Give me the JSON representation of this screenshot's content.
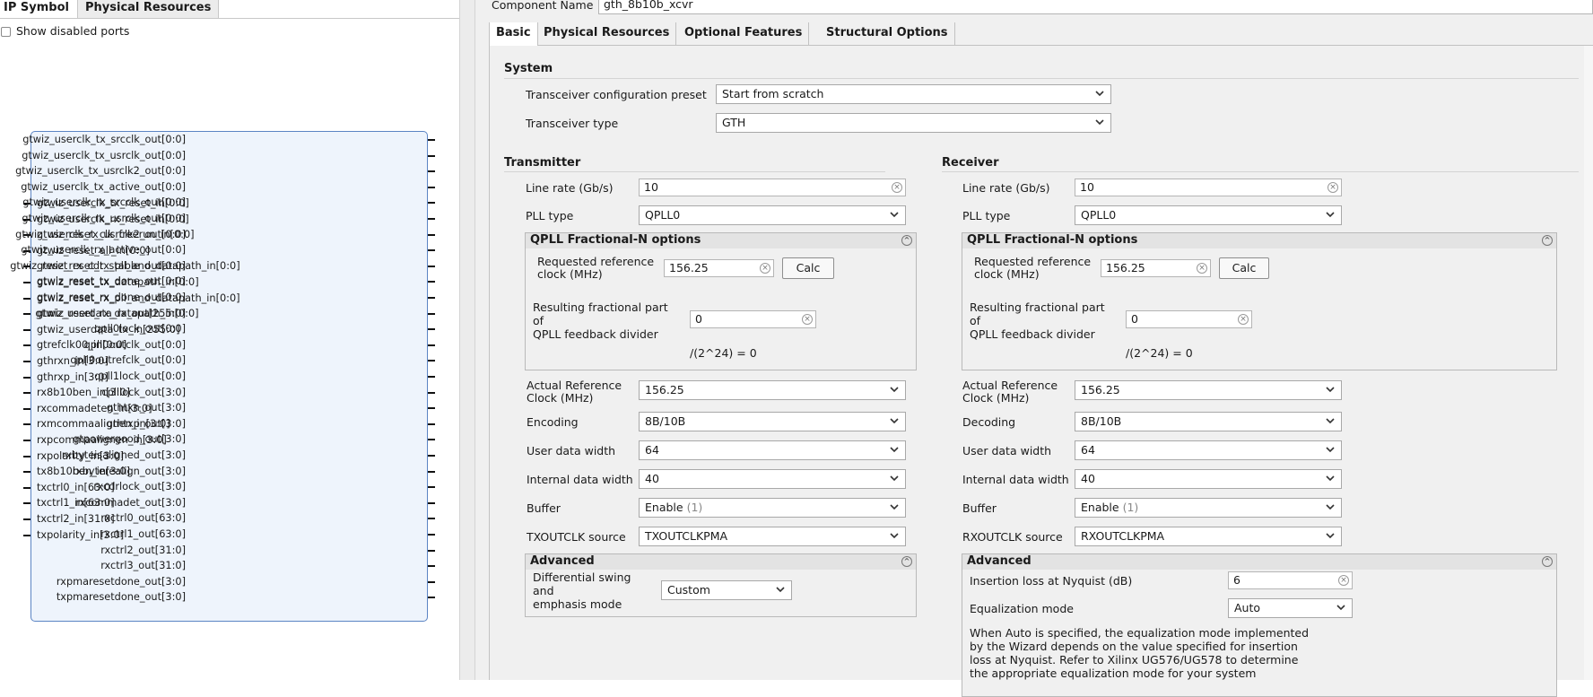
{
  "left_tabs": [
    "IP Symbol",
    "Physical Resources"
  ],
  "show_disabled_ports": "Show disabled ports",
  "input_ports": [
    "gtwiz_userclk_tx_reset_in[0:0]",
    "gtwiz_userclk_rx_reset_in[0:0]",
    "gtwiz_reset_clk_freerun_in[0:0]",
    "gtwiz_reset_all_in[0:0]",
    "gtwiz_reset_tx_pll_and_datapath_in[0:0]",
    "gtwiz_reset_tx_datapath_in[0:0]",
    "gtwiz_reset_rx_pll_and_datapath_in[0:0]",
    "gtwiz_reset_rx_datapath_in[0:0]",
    "gtwiz_userdata_tx_in[255:0]",
    "gtrefclk00_in[0:0]",
    "gthrxn_in[3:0]",
    "gthrxp_in[3:0]",
    "rx8b10ben_in[3:0]",
    "rxcommadeten_in[3:0]",
    "rxmcommaalignen_in[3:0]",
    "rxpcommaalignen_in[3:0]",
    "rxpolarity_in[3:0]",
    "tx8b10ben_in[3:0]",
    "txctrl0_in[63:0]",
    "txctrl1_in[63:0]",
    "txctrl2_in[31:0]",
    "txpolarity_in[3:0]"
  ],
  "output_ports": [
    "gtwiz_userclk_tx_srcclk_out[0:0]",
    "gtwiz_userclk_tx_usrclk_out[0:0]",
    "gtwiz_userclk_tx_usrclk2_out[0:0]",
    "gtwiz_userclk_tx_active_out[0:0]",
    "gtwiz_userclk_rx_srcclk_out[0:0]",
    "gtwiz_userclk_rx_usrclk_out[0:0]",
    "gtwiz_userclk_rx_usrclk2_out[0:0]",
    "gtwiz_userclk_rx_active_out[0:0]",
    "gtwiz_reset_rx_cdr_stable_out[0:0]",
    "gtwiz_reset_tx_done_out[0:0]",
    "gtwiz_reset_rx_done_out[0:0]",
    "gtwiz_userdata_rx_out[255:0]",
    "qpll0lock_out[0:0]",
    "qpll0outclk_out[0:0]",
    "qpll0outrefclk_out[0:0]",
    "qpll1lock_out[0:0]",
    "cplllock_out[3:0]",
    "gthtxn_out[3:0]",
    "gthtxp_out[3:0]",
    "gtpowergood_out[3:0]",
    "rxbyteisaligned_out[3:0]",
    "rxbyterealign_out[3:0]",
    "rxcdrlock_out[3:0]",
    "rxcommadet_out[3:0]",
    "rxctrl0_out[63:0]",
    "rxctrl1_out[63:0]",
    "rxctrl2_out[31:0]",
    "rxctrl3_out[31:0]",
    "rxpmaresetdone_out[3:0]",
    "txpmaresetdone_out[3:0]"
  ],
  "component": {
    "label": "Component Name",
    "value": "gth_8b10b_xcvr"
  },
  "right_tabs": [
    "Basic",
    "Physical Resources",
    "Optional Features",
    "Structural Options"
  ],
  "system": {
    "title": "System",
    "preset_label": "Transceiver configuration preset",
    "preset_value": "Start from scratch",
    "type_label": "Transceiver type",
    "type_value": "GTH"
  },
  "transmitter": {
    "title": "Transmitter",
    "line_rate_label": "Line rate (Gb/s)",
    "line_rate": "10",
    "pll_type_label": "PLL type",
    "pll_type": "QPLL0",
    "qpll_title": "QPLL Fractional-N options",
    "req_ref_label1": "Requested reference",
    "req_ref_label2": "clock (MHz)",
    "req_ref": "156.25",
    "calc": "Calc",
    "frac_label1": "Resulting fractional part",
    "frac_label2": "of",
    "frac_label3": "QPLL feedback divider",
    "frac": "0",
    "frac_suffix": "/(2^24) = 0",
    "actual_ref_label1": "Actual Reference",
    "actual_ref_label2": "Clock (MHz)",
    "actual_ref": "156.25",
    "encoding_label": "Encoding",
    "encoding": "8B/10B",
    "user_width_label": "User data width",
    "user_width": "64",
    "internal_width_label": "Internal data width",
    "internal_width": "40",
    "buffer_label": "Buffer",
    "buffer": "Enable",
    "buffer_hint": "(1)",
    "outclk_label": "TXOUTCLK source",
    "outclk": "TXOUTCLKPMA",
    "advanced_title": "Advanced",
    "swing_label1": "Differential swing",
    "swing_label2": "and",
    "swing_label3": "emphasis mode",
    "swing": "Custom"
  },
  "receiver": {
    "title": "Receiver",
    "line_rate_label": "Line rate (Gb/s)",
    "line_rate": "10",
    "pll_type_label": "PLL type",
    "pll_type": "QPLL0",
    "qpll_title": "QPLL Fractional-N options",
    "req_ref_label1": "Requested reference",
    "req_ref_label2": "clock (MHz)",
    "req_ref": "156.25",
    "calc": "Calc",
    "frac_label1": "Resulting fractional part",
    "frac_label2": "of",
    "frac_label3": "QPLL feedback divider",
    "frac": "0",
    "frac_suffix": "/(2^24) = 0",
    "actual_ref_label1": "Actual Reference",
    "actual_ref_label2": "Clock (MHz)",
    "actual_ref": "156.25",
    "decoding_label": "Decoding",
    "decoding": "8B/10B",
    "user_width_label": "User data width",
    "user_width": "64",
    "internal_width_label": "Internal data width",
    "internal_width": "40",
    "buffer_label": "Buffer",
    "buffer": "Enable",
    "buffer_hint": "(1)",
    "outclk_label": "RXOUTCLK source",
    "outclk": "RXOUTCLKPMA",
    "advanced_title": "Advanced",
    "insertion_label": "Insertion loss at Nyquist (dB)",
    "insertion": "6",
    "eq_label": "Equalization mode",
    "eq": "Auto",
    "note1": "When Auto is specified, the equalization mode implemented",
    "note2": "by the Wizard depends on the value specified for insertion",
    "note3": "loss at Nyquist. Refer to Xilinx UG576/UG578 to determine",
    "note4": "the appropriate equalization mode for your system"
  }
}
